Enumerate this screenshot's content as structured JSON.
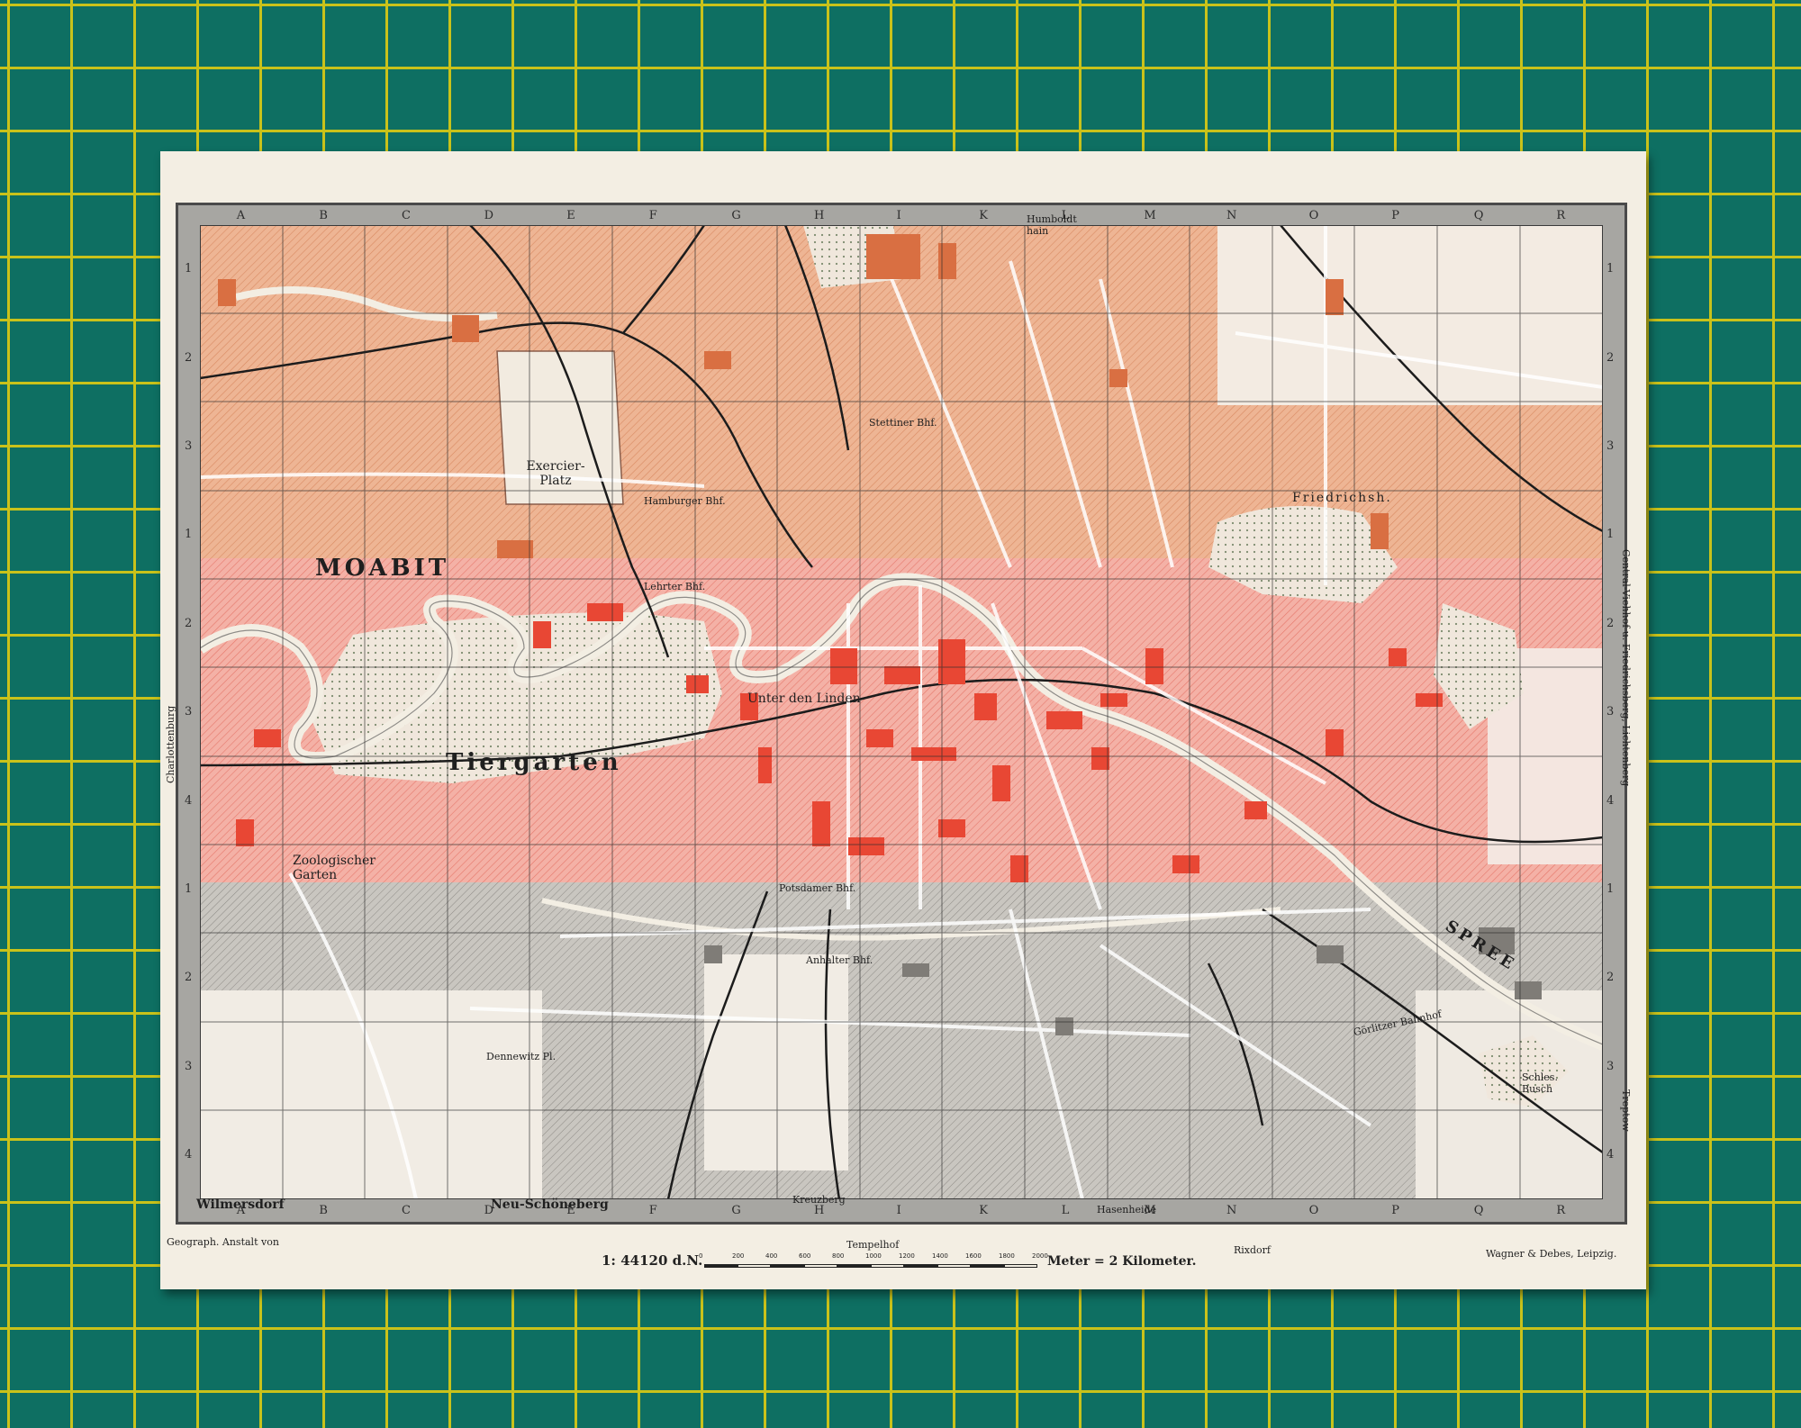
{
  "map": {
    "column_letters": [
      "A",
      "B",
      "C",
      "D",
      "E",
      "F",
      "G",
      "H",
      "I",
      "K",
      "L",
      "M",
      "N",
      "O",
      "P",
      "Q",
      "R"
    ],
    "row_numbers": [
      "1",
      "2",
      "3",
      "1",
      "2",
      "3",
      "4",
      "1",
      "2",
      "3",
      "4"
    ],
    "districts": {
      "moabit": "MOABIT",
      "tiergarten": "Tiergarten",
      "exercier_platz": "Exercier-Platz",
      "friedrichshain": "Friedrichsh.",
      "wilmersdorf": "Wilmersdorf",
      "neu_schoeneberg": "Neu-Schöneberg",
      "kreuzberg": "Kreuzberg",
      "zoologischer_garten": "Zoologischer Garten",
      "unter_den_linden": "Unter den Linden",
      "humboldt_hain": "Humboldt hain",
      "spree": "SPREE",
      "anhalter_bhf": "Anhalter Bhf.",
      "goerlitzer_bahnhof": "Görlitzer Bahnhof",
      "hasenheide": "Hasenheide",
      "dennewitz": "Dennewitz Pl.",
      "tempelhof": "Tempelhof",
      "rixdorf": "Rixdorf",
      "charlottenburg": "Charlottenburg",
      "treptow": "Treptow",
      "friedrichsberg": "Central-Viehhof u. Friedrichsberg, Lichtenberg",
      "schles_busch": "Schles. Busch",
      "potsdamer_bhf": "Potsdamer Bhf.",
      "stettiner_bhf": "Stettiner Bhf.",
      "lehrter_bhf": "Lehrter Bhf.",
      "hamburger_bhf": "Hamburger Bhf."
    },
    "colors": {
      "board": "#0e6f62",
      "grid_lines": "#c9c21a",
      "paper": "#f3eee3",
      "frame_gray": "#a7a6a2",
      "north_orange": "#e8a682",
      "center_red": "#ec5a4a",
      "center_pink": "#f2aaa0",
      "south_gray": "#b9b6b0",
      "water": "#f3eee3"
    }
  },
  "footer": {
    "publisher_left": "Geograph. Anstalt von",
    "scale": "1: 44120 d.N.",
    "scale_ticks": [
      "0",
      "200",
      "400",
      "600",
      "800",
      "1000",
      "1200",
      "1400",
      "1600",
      "1800",
      "2000"
    ],
    "scale_unit": "Meter = 2 Kilometer.",
    "publisher_right": "Wagner & Debes, Leipzig."
  }
}
